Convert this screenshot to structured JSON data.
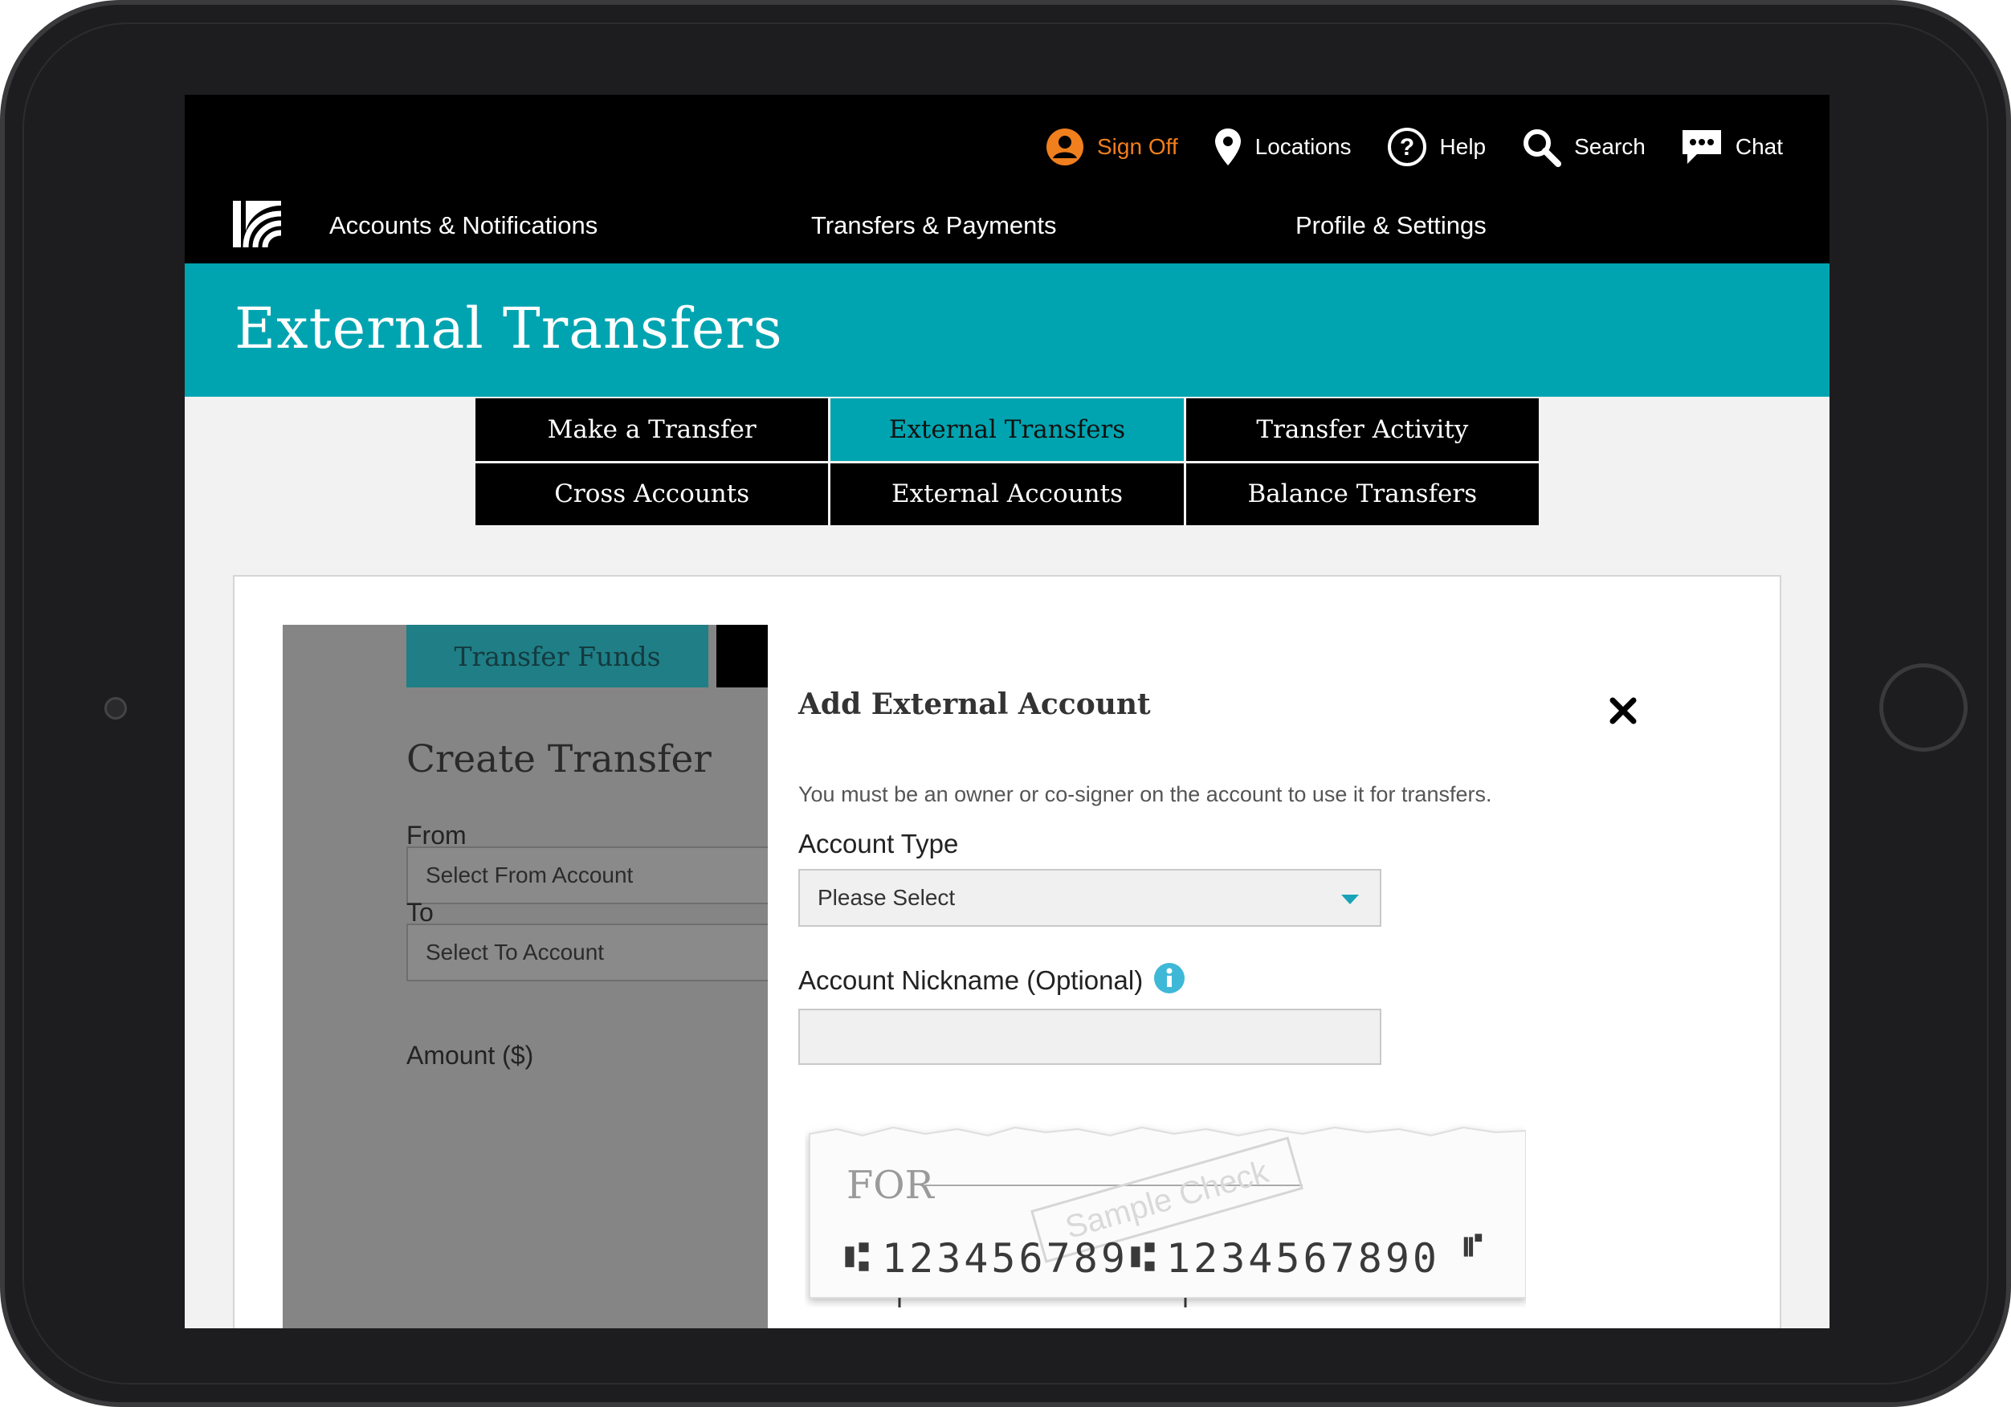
{
  "header": {
    "utility": {
      "sign_off": "Sign Off",
      "locations": "Locations",
      "help": "Help",
      "search": "Search",
      "chat": "Chat"
    },
    "nav": [
      {
        "label": "Accounts & Notifications"
      },
      {
        "label": "Transfers & Payments"
      },
      {
        "label": "Profile & Settings"
      }
    ]
  },
  "page": {
    "title": "External Transfers"
  },
  "subtabs": [
    {
      "label": "Make a Transfer",
      "active": false
    },
    {
      "label": "External Transfers",
      "active": true
    },
    {
      "label": "Transfer Activity",
      "active": false
    },
    {
      "label": "Cross Accounts",
      "active": false
    },
    {
      "label": "External Accounts",
      "active": false
    },
    {
      "label": "Balance Transfers",
      "active": false
    }
  ],
  "background_form": {
    "tab_label": "Transfer Funds",
    "title": "Create Transfer",
    "from_label": "From",
    "from_value": "Select From Account",
    "to_label": "To",
    "to_value": "Select To Account",
    "amount_label": "Amount ($)"
  },
  "modal": {
    "title": "Add External Account",
    "notice": "You must be an owner or co-signer on the account to use it for transfers.",
    "account_type_label": "Account Type",
    "account_type_value": "Please Select",
    "nickname_label": "Account Nickname (Optional)",
    "nickname_value": ""
  },
  "sample_check": {
    "for_label": "FOR",
    "stamp": "Sample Check",
    "routing_number": "123456789",
    "account_number": "1234567890"
  },
  "colors": {
    "accent_teal": "#00a4b0",
    "sign_off_orange": "#f07f1e",
    "header_black": "#000000"
  },
  "icons": {
    "sign_off": "user-circle-icon",
    "locations": "map-pin-icon",
    "help": "question-circle-icon",
    "search": "search-icon",
    "chat": "chat-bubble-icon",
    "close": "close-icon",
    "info": "info-icon"
  }
}
